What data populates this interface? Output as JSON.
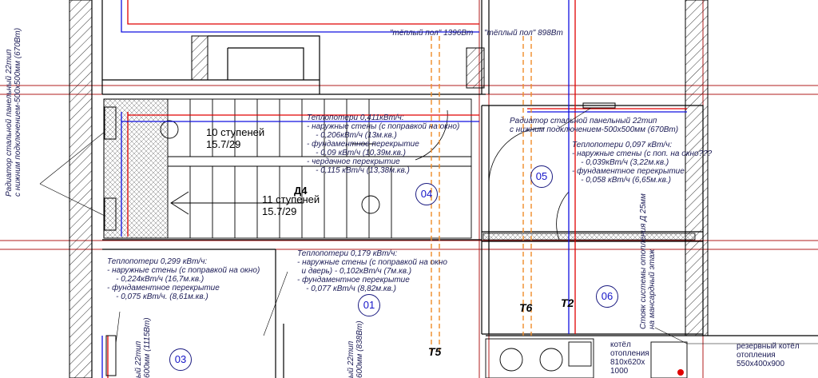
{
  "floor_heating": {
    "left": "\"тёплый пол\" 1396Вт",
    "right": "\"тёплый пол\" 898Вт"
  },
  "radiator_notes": {
    "vertical_left": "Радиатор стальной панельный 22тип\nс нижним подключением-500х500мм (670Вт)",
    "room05": "Радиатор стальной панельный 22тип\nс нижним подключением-500х500мм (670Вт)",
    "bottom_a": "ый 22тип\n600мм (1115Вт)",
    "bottom_b": "ый 22тип\n600мм (838Вт)"
  },
  "heat_loss": {
    "room04": "Теплопотери 0,411кВт/ч:\n- наружные стены (с поправкой на окно)\n    - 0,206кВт/ч (13м.кв.)\n- фундаментное перекрытие\n    - 0,09 кВт/ч (10,39м.кв.)\n- чердачное перекрытие\n    - 0,115 кВт/ч (13,38м.кв.)",
    "room05": "Теплопотери 0,097 кВт/ч:\n- наружные стены (с поп. на окно???\n    - 0,039кВт/ч (3,22м.кв.)\n- фундаментное перекрытие\n    - 0,058 кВт/ч (6,65м.кв.)",
    "room03": "Теплопотери 0,299 кВт/ч:\n- наружные стены (с поправкой на окно)\n    - 0,224кВт/ч (16,7м.кв.)\n- фундаментное перекрытие\n    - 0,075 кВт/ч. (8,61м.кв.)",
    "room01": "Теплопотери 0,179 кВт/ч:\n- наружные стены (с поправкой на окно\n  и дверь) - 0,102кВт/ч (7м.кв.)\n- фундаментное перекрытие\n    - 0,077 кВт/ч (8,82м.кв.)"
  },
  "stairs": {
    "upper": "10 ступеней\n15.7/29",
    "lower": "11 ступеней\n15.7/29",
    "mark": "Д4"
  },
  "rooms": {
    "r01": "01",
    "r03": "03",
    "r04": "04",
    "r05": "05",
    "r06": "06"
  },
  "risers": {
    "t2": "T2",
    "t5": "T5",
    "t6": "T6"
  },
  "riser_note": "Стояк системы отопления Д 25мм\nна мансардный этаж",
  "boiler": {
    "label": "котёл\nотопления\n810х620х\n1000",
    "reserve": "резервный котёл\nотопления\n550х400х900"
  },
  "colors": {
    "wall": "#000000",
    "grid": "#b01e1e",
    "supply": "#e00000",
    "return": "#1010e0",
    "floor_heat": "#f08c28",
    "text": "#1a1a55",
    "room_num": "#1414c8"
  }
}
